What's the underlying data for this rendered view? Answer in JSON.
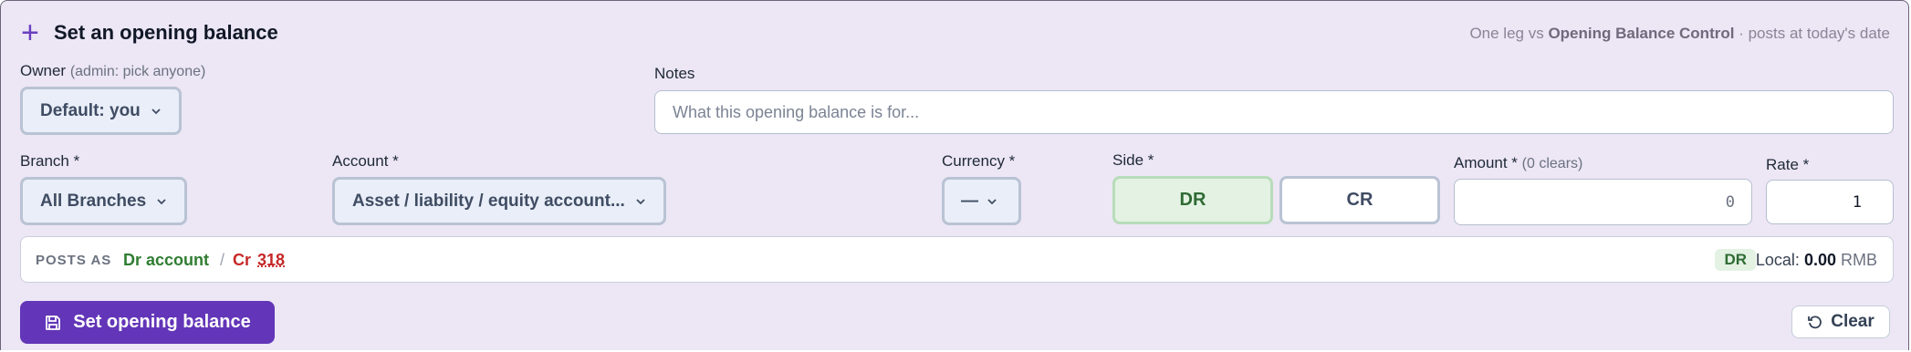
{
  "header": {
    "title": "Set an opening balance",
    "hint_prefix": "One leg vs",
    "hint_bold": "Opening Balance Control",
    "hint_suffix": "· posts at today's date"
  },
  "owner": {
    "label": "Owner",
    "sub": "(admin: pick anyone)",
    "value": "Default: you"
  },
  "notes": {
    "label": "Notes",
    "placeholder": "What this opening balance is for..."
  },
  "branch": {
    "label": "Branch *",
    "value": "All Branches"
  },
  "account": {
    "label": "Account *",
    "value": "Asset / liability / equity account..."
  },
  "currency": {
    "label": "Currency *",
    "value": "—"
  },
  "side": {
    "label": "Side *",
    "dr": "DR",
    "cr": "CR",
    "selected": "DR"
  },
  "amount": {
    "label": "Amount *",
    "sub": "(0 clears)",
    "value": "0"
  },
  "rate": {
    "label": "Rate *",
    "value": "1"
  },
  "posts_as": {
    "label": "POSTS AS",
    "dr_text": "Dr account",
    "sep": "/",
    "cr_prefix": "Cr",
    "cr_account": "318",
    "badge": "DR",
    "local_label": "Local:",
    "local_value": "0.00",
    "local_currency": "RMB"
  },
  "actions": {
    "submit": "Set opening balance",
    "clear": "Clear"
  },
  "colors": {
    "accent": "#6335b8",
    "dr_green": "#2f7d32",
    "cr_red": "#c62828"
  }
}
